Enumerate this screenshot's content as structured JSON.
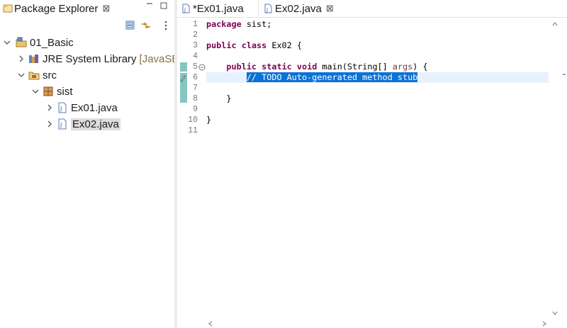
{
  "explorer": {
    "title": "Package Explorer",
    "close": "⊠",
    "tree": [
      {
        "label": "01_Basic"
      },
      {
        "label": "JRE System Library",
        "decoration": "[JavaSE-"
      },
      {
        "label": "src"
      },
      {
        "label": "sist"
      },
      {
        "label": "Ex01.java"
      },
      {
        "label": "Ex02.java"
      }
    ]
  },
  "editor": {
    "tabs": [
      {
        "label": "*Ex01.java"
      },
      {
        "label": "Ex02.java",
        "close": "⊠"
      }
    ],
    "line_numbers": [
      "1",
      "2",
      "3",
      "4",
      "5",
      "6",
      "7",
      "8",
      "9",
      "10",
      "11"
    ],
    "code": {
      "l1_kw": "package",
      "l1_rest": " sist;",
      "l3_kw1": "public",
      "l3_kw2": "class",
      "l3_rest": " Ex02 {",
      "l5_indent": "    ",
      "l5_kw1": "public",
      "l5_kw2": "static",
      "l5_kw3": "void",
      "l5_mid": " main(String[] ",
      "l5_param": "args",
      "l5_end": ") {",
      "l6_indent": "        ",
      "l6_comment": "// TODO Auto-generated method stub",
      "l8": "    }",
      "l10": "}"
    }
  },
  "colors": {
    "keyword": "#7f0055",
    "selection": "#0b72d6",
    "current_line": "#e8f2fe",
    "gutter_marker": "#85c7bf"
  }
}
